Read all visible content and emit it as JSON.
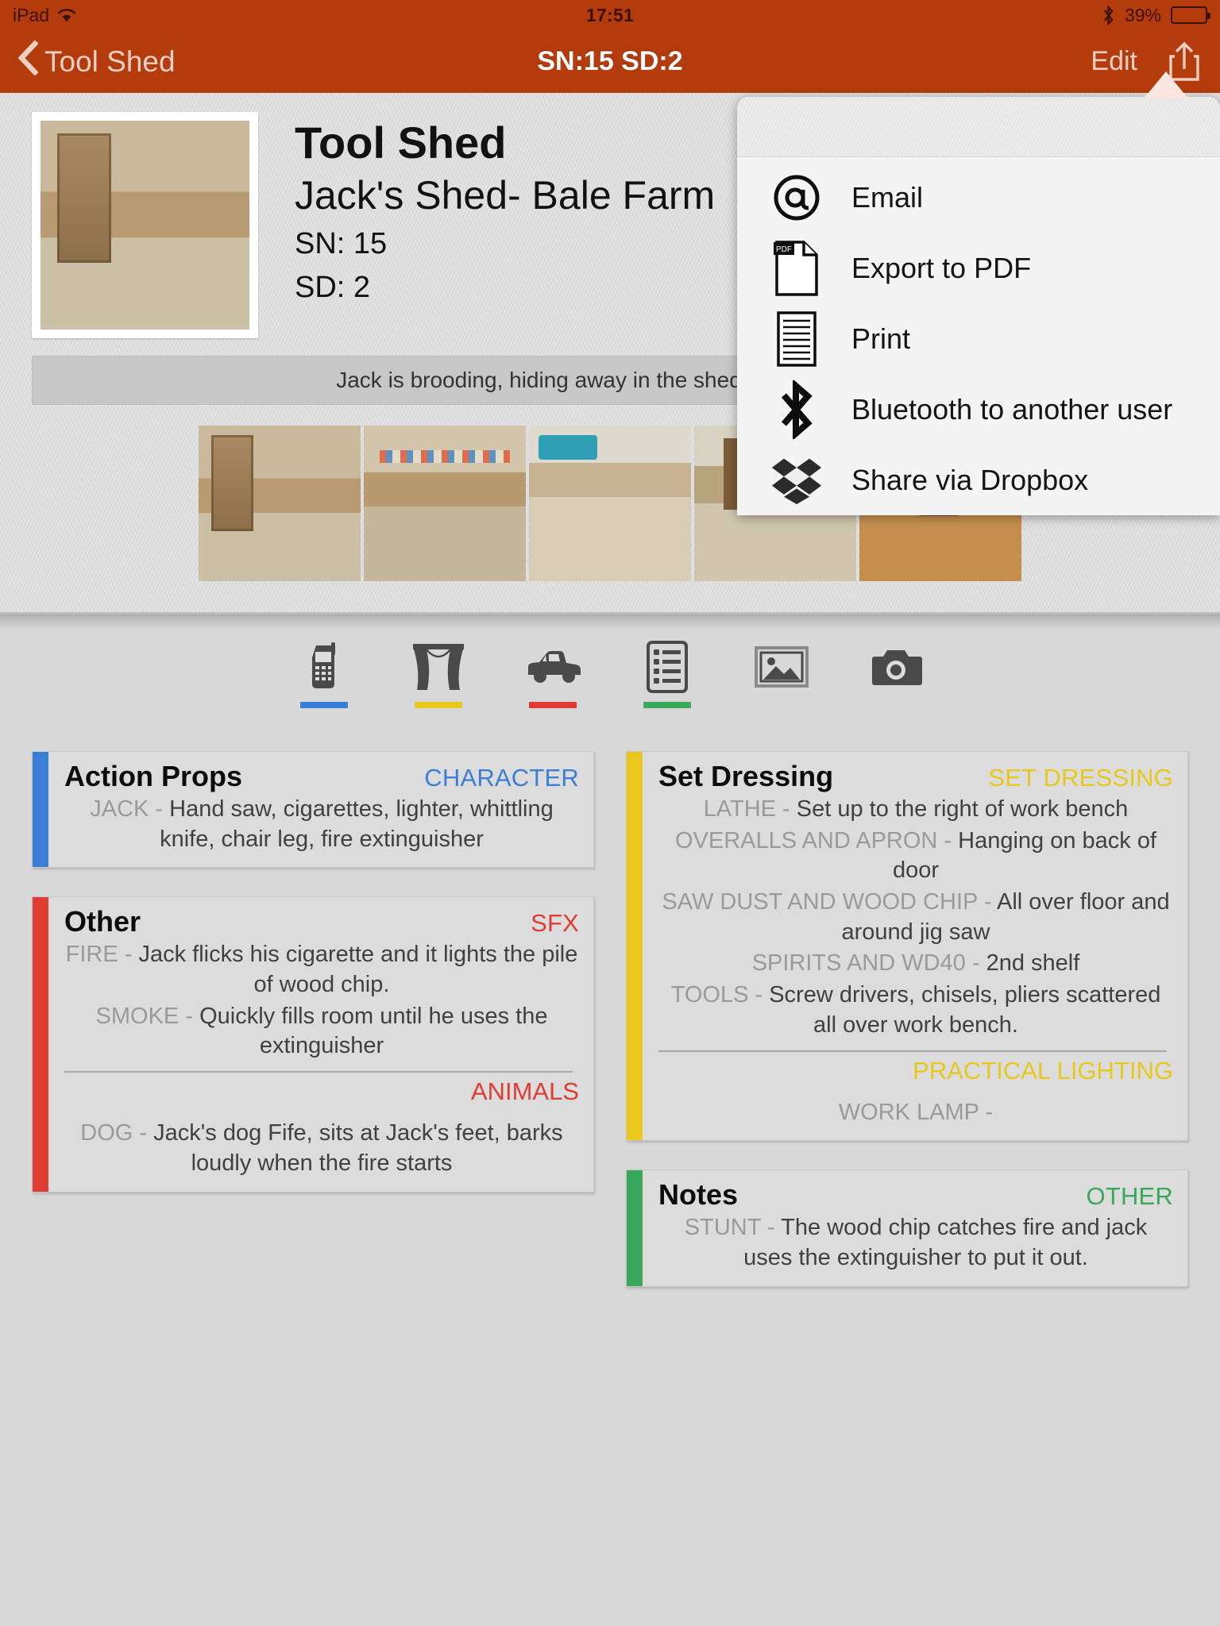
{
  "statusbar": {
    "device_label": "iPad",
    "wifi_icon": "wifi-icon",
    "time": "17:51",
    "bluetooth_icon": "bluetooth-icon",
    "battery_percent": "39%",
    "battery_level": 39
  },
  "navbar": {
    "back_label": "Tool Shed",
    "back_icon": "chevron-left-icon",
    "title": "SN:15 SD:2",
    "edit_label": "Edit",
    "share_icon": "share-icon"
  },
  "header": {
    "hero_image_name": "tool-shed-hero-photo",
    "title": "Tool Shed",
    "subtitle": "Jack's Shed- Bale Farm",
    "scene_number": "SN: 15",
    "scene_day": "SD: 2",
    "description": "Jack is brooding, hiding away in the shed. He accidenta",
    "thumbnails": [
      {
        "name": "thumb-workbench-lathe"
      },
      {
        "name": "thumb-shelf-tools"
      },
      {
        "name": "thumb-hand-tools"
      },
      {
        "name": "thumb-bench-grinder"
      },
      {
        "name": "thumb-dog-on-floor"
      }
    ]
  },
  "tabbar": {
    "tabs": [
      {
        "name": "tab-cast",
        "icon": "mobile-phone-icon",
        "underline": "#3a7fd5"
      },
      {
        "name": "tab-set",
        "icon": "stage-curtain-icon",
        "underline": "#e8c81e"
      },
      {
        "name": "tab-vehicles",
        "icon": "car-icon",
        "underline": "#e03c31"
      },
      {
        "name": "tab-props-list",
        "icon": "list-icon",
        "underline": "#3aa85a"
      },
      {
        "name": "tab-gallery",
        "icon": "image-icon",
        "underline": ""
      },
      {
        "name": "tab-camera",
        "icon": "camera-icon",
        "underline": ""
      }
    ]
  },
  "cards": {
    "left": [
      {
        "name": "card-action-props",
        "title": "Action Props",
        "stripe": "#3a7fd5",
        "groups": [
          {
            "tag": "CHARACTER",
            "tag_color": "#3a7fd5",
            "tag_position": "inline",
            "rows": [
              {
                "key": "JACK",
                "value": "Hand saw, cigarettes, lighter, whittling knife, chair leg, fire extinguisher"
              }
            ]
          }
        ]
      },
      {
        "name": "card-other",
        "title": "Other",
        "stripe": "#e03c31",
        "groups": [
          {
            "tag": "SFX",
            "tag_color": "#e03c31",
            "tag_position": "inline",
            "rows": [
              {
                "key": "FIRE",
                "value": "Jack flicks his cigarette and it lights the pile of wood chip."
              },
              {
                "key": "SMOKE",
                "value": "Quickly fills room until he uses the extinguisher"
              }
            ]
          },
          {
            "tag": "ANIMALS",
            "tag_color": "#e03c31",
            "tag_position": "right",
            "rows": [
              {
                "key": "DOG",
                "value": "Jack's dog Fife, sits at Jack's feet, barks loudly when the fire starts"
              }
            ]
          }
        ]
      }
    ],
    "right": [
      {
        "name": "card-set-dressing",
        "title": "Set Dressing",
        "stripe": "#e8c81e",
        "groups": [
          {
            "tag": "SET DRESSING",
            "tag_color": "#e8c81e",
            "tag_position": "inline",
            "rows": [
              {
                "key": "LATHE",
                "value": "Set up to the right of work bench"
              },
              {
                "key": "OVERALLS AND APRON",
                "value": "Hanging on back of door"
              },
              {
                "key": "SAW DUST AND WOOD CHIP",
                "value": "All over floor and around jig saw"
              },
              {
                "key": "SPIRITS AND WD40",
                "value": "2nd shelf"
              },
              {
                "key": "TOOLS",
                "value": "Screw drivers, chisels, pliers scattered all over work bench."
              }
            ]
          },
          {
            "tag": "PRACTICAL LIGHTING",
            "tag_color": "#e8c81e",
            "tag_position": "right",
            "rows": [
              {
                "key": "WORK LAMP",
                "value": ""
              }
            ]
          }
        ]
      },
      {
        "name": "card-notes",
        "title": "Notes",
        "stripe": "#3aa85a",
        "groups": [
          {
            "tag": "OTHER",
            "tag_color": "#3aa85a",
            "tag_position": "inline",
            "rows": [
              {
                "key": "STUNT",
                "value": "The wood chip catches fire and jack uses the extinguisher to put it out."
              }
            ]
          }
        ]
      }
    ]
  },
  "popover": {
    "items": [
      {
        "name": "menu-item-email",
        "icon": "at-sign-icon",
        "label": "Email"
      },
      {
        "name": "menu-item-export-pdf",
        "icon": "pdf-file-icon",
        "label": "Export to PDF"
      },
      {
        "name": "menu-item-print",
        "icon": "printer-doc-icon",
        "label": "Print"
      },
      {
        "name": "menu-item-bluetooth",
        "icon": "bluetooth-icon",
        "label": "Bluetooth to another user"
      },
      {
        "name": "menu-item-dropbox",
        "icon": "dropbox-icon",
        "label": "Share via Dropbox"
      }
    ]
  },
  "colors": {
    "navbar": "#b43b0c",
    "panel": "#dcdcdc",
    "page": "#d8d8d8"
  }
}
